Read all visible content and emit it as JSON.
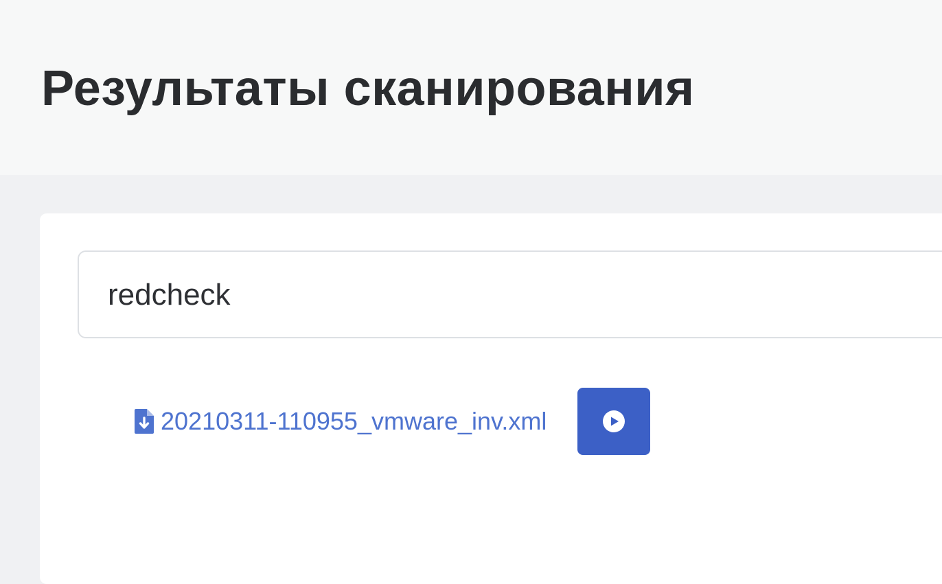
{
  "header": {
    "title": "Результаты сканирования"
  },
  "search": {
    "value": "redcheck",
    "placeholder": ""
  },
  "results": {
    "items": [
      {
        "filename": "20210311-110955_vmware_inv.xml",
        "icon": "file-download-icon",
        "action_icon": "play-circle-icon"
      }
    ]
  },
  "colors": {
    "link": "#4e73cf",
    "button": "#3c60c6",
    "title": "#2a2c2f",
    "header_bg": "#f7f8f8",
    "page_bg": "#f0f1f3"
  }
}
